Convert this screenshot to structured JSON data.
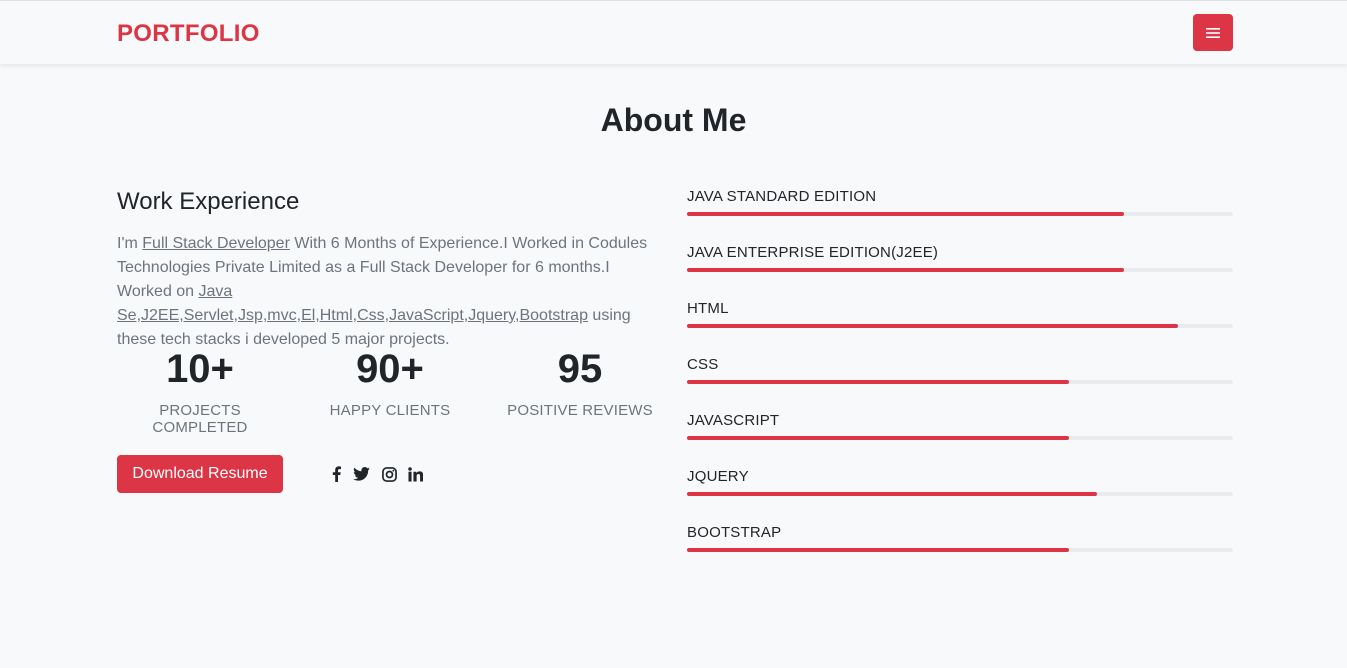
{
  "nav": {
    "brand": "PORTFOLIO",
    "menu_icon": "hamburger-icon"
  },
  "about": {
    "title": "About Me",
    "work_heading": "Work Experience",
    "paragraph": {
      "p1": "I'm ",
      "role": "Full Stack Developer",
      "p2": " With 6 Months of Experience.I Worked in Codules Technologies Private Limited as a Full Stack Developer for 6 months.I Worked on ",
      "stack": "Java Se,J2EE,Servlet,Jsp,mvc,El,Html,Css,JavaScript,Jquery,Bootstrap",
      "p3": " using these tech stacks i developed 5 major projects."
    },
    "stats": [
      {
        "value": "10+",
        "label": "PROJECTS COMPLETED"
      },
      {
        "value": "90+",
        "label": "HAPPY CLIENTS"
      },
      {
        "value": "95",
        "label": "POSITIVE REVIEWS"
      }
    ],
    "download_label": "Download Resume",
    "social_icons": [
      "facebook-icon",
      "twitter-icon",
      "instagram-icon",
      "linkedin-icon"
    ]
  },
  "skills": [
    {
      "name": "JAVA STANDARD EDITION",
      "percent": 80
    },
    {
      "name": "JAVA ENTERPRISE EDITION(J2EE)",
      "percent": 80
    },
    {
      "name": "HTML",
      "percent": 90
    },
    {
      "name": "CSS",
      "percent": 70
    },
    {
      "name": "JAVASCRIPT",
      "percent": 70
    },
    {
      "name": "JQUERY",
      "percent": 75
    },
    {
      "name": "BOOTSTRAP",
      "percent": 70
    }
  ],
  "colors": {
    "accent": "#dc3545",
    "background": "#f8f9fa",
    "text": "#212529",
    "muted": "#6c757d",
    "track": "#e9ecef"
  }
}
